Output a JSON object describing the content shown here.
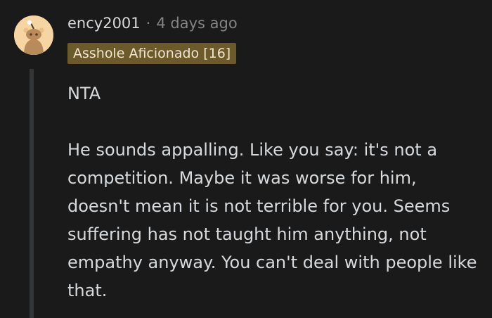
{
  "comment": {
    "username": "ency2001",
    "separator": "·",
    "timestamp": "4 days ago",
    "flair": "Asshole Aficionado [16]",
    "avatar_icon": "reddit-snoo-avatar-icon",
    "paragraphs": [
      "NTA",
      "He sounds appalling. Like you say: it's not a competition. Maybe it was worse for him, doesn't mean it is not terrible for you. Seems suffering has not taught him anything, not empathy anyway. You can't deal with people like that."
    ]
  },
  "colors": {
    "background": "#1a1a1b",
    "text": "#d7dadc",
    "muted": "#818384",
    "flair_bg": "#6d5a2b",
    "avatar_bg": "#f6d5a3",
    "thread_line": "#343536"
  }
}
